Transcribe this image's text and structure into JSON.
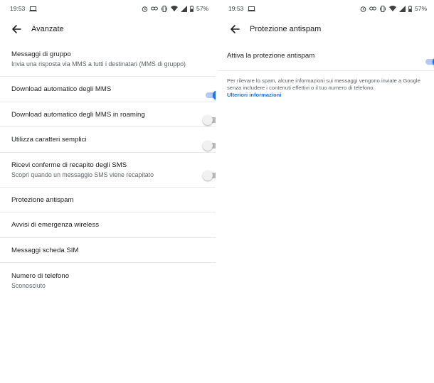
{
  "left": {
    "status": {
      "time": "19:53",
      "battery": "57%"
    },
    "appbar": {
      "title": "Avanzate"
    },
    "items": [
      {
        "title": "Messaggi di gruppo",
        "subtitle": "Invia una risposta via MMS a tutti i destinatari (MMS di gruppo)"
      },
      {
        "title": "Download automatico degli MMS",
        "toggle": true
      },
      {
        "title": "Download automatico degli MMS in roaming",
        "toggle": false
      },
      {
        "title": "Utilizza caratteri semplici",
        "toggle": false
      },
      {
        "title": "Ricevi conferme di recapito degli SMS",
        "subtitle": "Scopri quando un messaggio SMS viene recapitato",
        "toggle": false
      },
      {
        "title": "Protezione antispam"
      },
      {
        "title": "Avvisi di emergenza wireless"
      },
      {
        "title": "Messaggi scheda SIM"
      },
      {
        "title": "Numero di telefono",
        "subtitle": "Sconosciuto"
      }
    ]
  },
  "right": {
    "status": {
      "time": "19:53",
      "battery": "57%"
    },
    "appbar": {
      "title": "Protezione antispam"
    },
    "setting": {
      "title": "Attiva la protezione antispam",
      "toggle": true
    },
    "description": "Per rilevare lo spam, alcune informazioni sui messaggi vengono inviate a Google senza includere i contenuti effettivi o il tuo numero di telefono.",
    "link": "Ulteriori informazioni"
  },
  "colors": {
    "accent": "#1a73e8",
    "accent_track": "#aecbfa",
    "divider": "#e8eaed"
  },
  "icons": [
    "back-arrow-icon",
    "laptop-icon",
    "alarm-icon",
    "link-icon",
    "vibrate-icon",
    "wifi-icon",
    "signal-icon",
    "battery-icon"
  ]
}
